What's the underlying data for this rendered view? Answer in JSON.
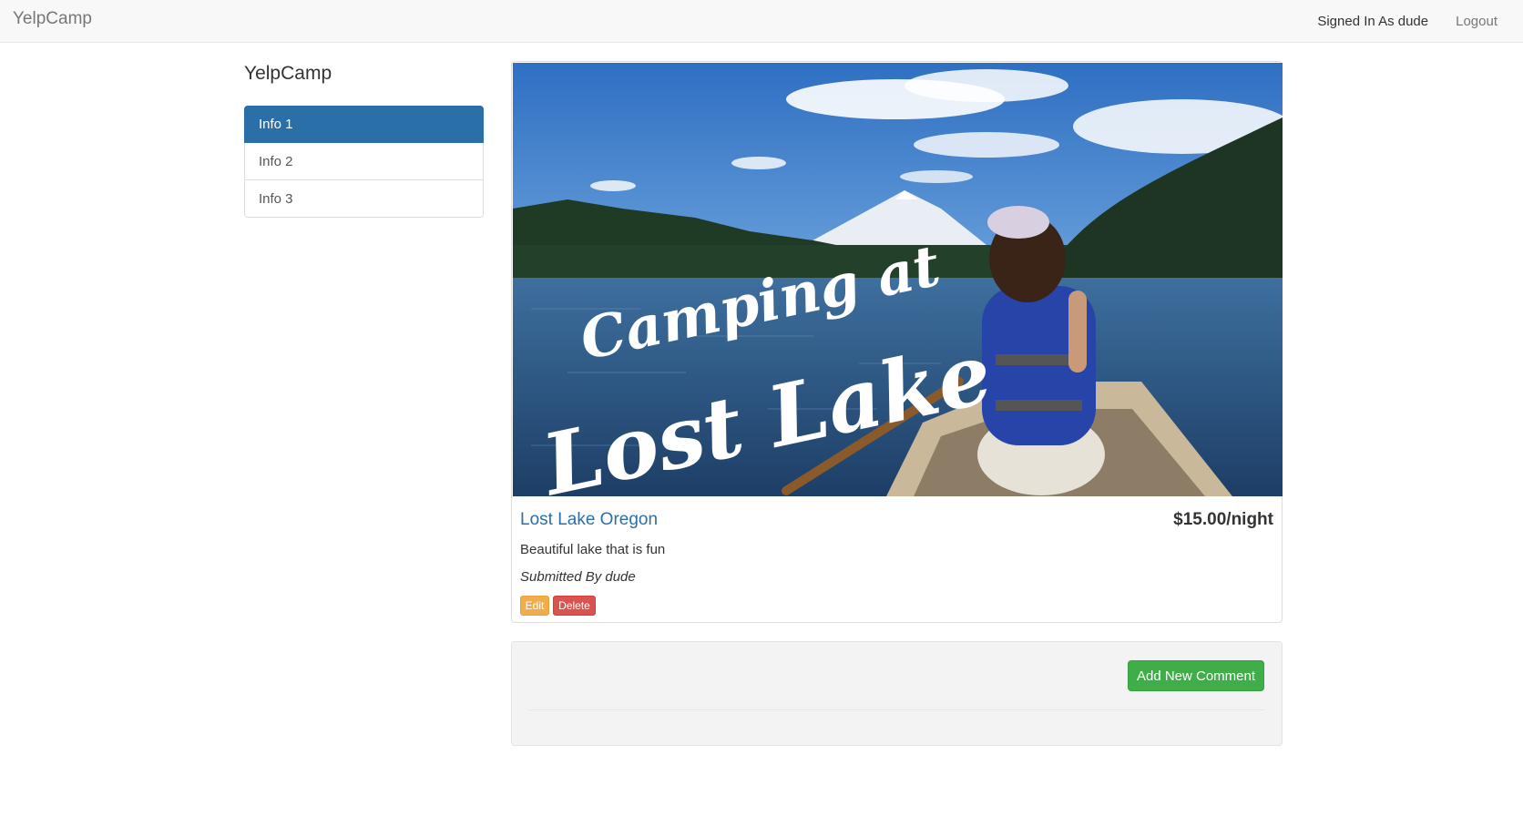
{
  "navbar": {
    "brand": "YelpCamp",
    "signed_in": "Signed In As dude",
    "logout": "Logout"
  },
  "sidebar": {
    "title": "YelpCamp",
    "items": [
      {
        "label": "Info 1",
        "active": true
      },
      {
        "label": "Info 2",
        "active": false
      },
      {
        "label": "Info 3",
        "active": false
      }
    ]
  },
  "campground": {
    "image_text_line1": "Camping at",
    "image_text_line2": "Lost Lake",
    "name": "Lost Lake Oregon",
    "price": "$15.00/night",
    "description": "Beautiful lake that is fun",
    "author": "Submitted By dude",
    "edit_label": "Edit",
    "delete_label": "Delete"
  },
  "comments": {
    "add_label": "Add New Comment"
  },
  "colors": {
    "primary": "#2b6fa8",
    "warning": "#f0ad4e",
    "danger": "#d9534f",
    "success": "#3fae49"
  }
}
